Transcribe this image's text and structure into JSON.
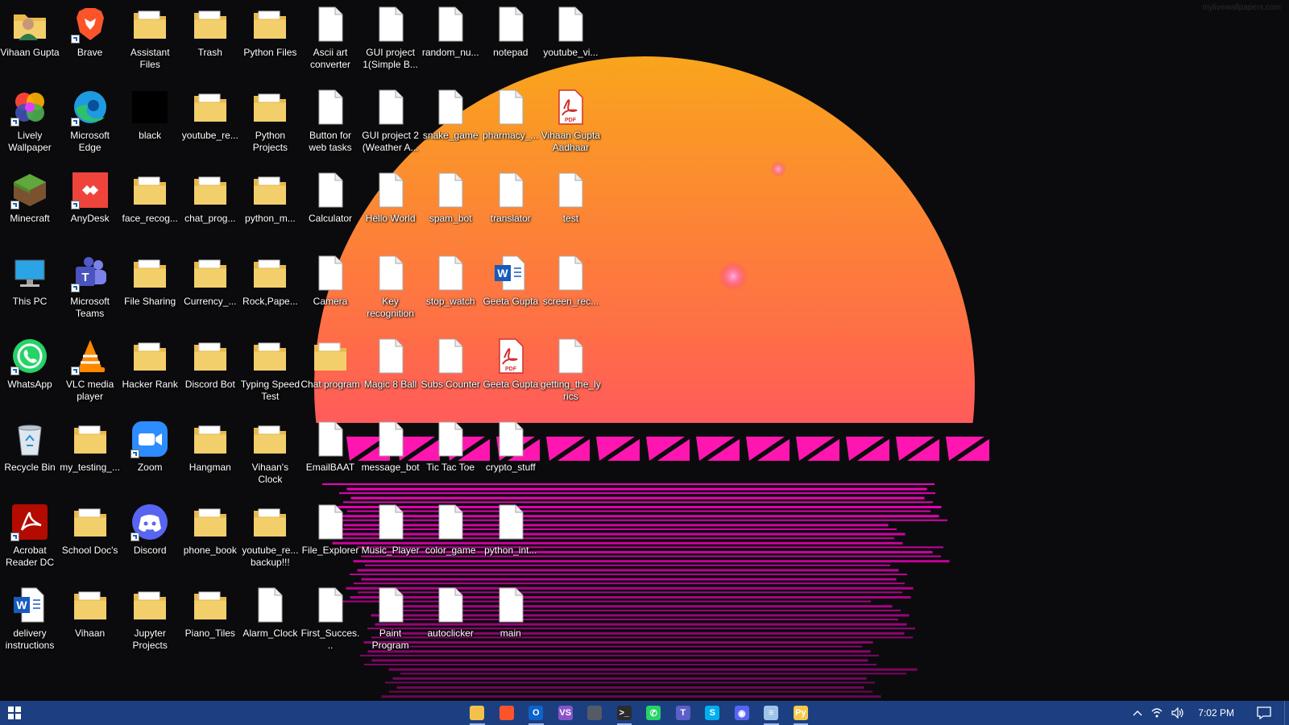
{
  "watermark": "mylivewallpapers.com",
  "colors": {
    "taskbar": "#1c3f82",
    "sun_top": "#f7a21b",
    "sun_bottom": "#ff1fa5",
    "water": "#ff00c8",
    "folder": "#f3cf6c"
  },
  "desktop": {
    "icons": [
      {
        "label": "Vihaan Gupta",
        "type": "user-folder"
      },
      {
        "label": "Lively Wallpaper",
        "type": "lively",
        "shortcut": true
      },
      {
        "label": "Minecraft",
        "type": "minecraft",
        "shortcut": true
      },
      {
        "label": "This PC",
        "type": "this-pc"
      },
      {
        "label": "WhatsApp",
        "type": "whatsapp",
        "shortcut": true
      },
      {
        "label": "Recycle Bin",
        "type": "recycle-bin"
      },
      {
        "label": "Acrobat Reader DC",
        "type": "acrobat",
        "shortcut": true
      },
      {
        "label": "delivery instructions",
        "type": "word-doc"
      },
      {
        "label": "Brave",
        "type": "brave",
        "shortcut": true
      },
      {
        "label": "Microsoft Edge",
        "type": "edge",
        "shortcut": true
      },
      {
        "label": "AnyDesk",
        "type": "anydesk",
        "shortcut": true
      },
      {
        "label": "Microsoft Teams",
        "type": "teams",
        "shortcut": true
      },
      {
        "label": "VLC media player",
        "type": "vlc",
        "shortcut": true
      },
      {
        "label": "my_testing_...",
        "type": "folder"
      },
      {
        "label": "School Doc's",
        "type": "folder"
      },
      {
        "label": "Vihaan",
        "type": "folder"
      },
      {
        "label": "Assistant Files",
        "type": "folder"
      },
      {
        "label": "black",
        "type": "black-image"
      },
      {
        "label": "face_recog...",
        "type": "folder"
      },
      {
        "label": "File Sharing",
        "type": "folder"
      },
      {
        "label": "Hacker Rank",
        "type": "folder"
      },
      {
        "label": "Zoom",
        "type": "zoom",
        "shortcut": true
      },
      {
        "label": "Discord",
        "type": "discord",
        "shortcut": true
      },
      {
        "label": "Jupyter Projects",
        "type": "folder"
      },
      {
        "label": "Trash",
        "type": "folder"
      },
      {
        "label": "youtube_re...",
        "type": "folder"
      },
      {
        "label": "chat_prog...",
        "type": "folder"
      },
      {
        "label": "Currency_...",
        "type": "folder"
      },
      {
        "label": "Discord Bot",
        "type": "folder"
      },
      {
        "label": "Hangman",
        "type": "folder"
      },
      {
        "label": "phone_book",
        "type": "folder"
      },
      {
        "label": "Piano_Tiles",
        "type": "folder"
      },
      {
        "label": "Python Files",
        "type": "folder"
      },
      {
        "label": "Python Projects",
        "type": "folder"
      },
      {
        "label": "python_m...",
        "type": "folder"
      },
      {
        "label": "Rock,Pape...",
        "type": "folder"
      },
      {
        "label": "Typing Speed Test",
        "type": "folder"
      },
      {
        "label": "Vihaan's Clock",
        "type": "folder"
      },
      {
        "label": "youtube_re... backup!!!",
        "type": "folder"
      },
      {
        "label": "Alarm_Clock",
        "type": "file"
      },
      {
        "label": "Ascii art converter",
        "type": "file"
      },
      {
        "label": "Button for web tasks",
        "type": "file"
      },
      {
        "label": "Calculator",
        "type": "file"
      },
      {
        "label": "Camera",
        "type": "file"
      },
      {
        "label": "Chat program",
        "type": "folder"
      },
      {
        "label": "EmailBAAT",
        "type": "file"
      },
      {
        "label": "File_Explorer",
        "type": "file"
      },
      {
        "label": "First_Succes...",
        "type": "file"
      },
      {
        "label": "GUI project 1(Simple B...",
        "type": "file"
      },
      {
        "label": "GUI project 2 (Weather A...",
        "type": "file"
      },
      {
        "label": "Hello World",
        "type": "file"
      },
      {
        "label": "Key recognition",
        "type": "file"
      },
      {
        "label": "Magic 8 Ball",
        "type": "file"
      },
      {
        "label": "message_bot",
        "type": "file"
      },
      {
        "label": "Music_Player",
        "type": "file"
      },
      {
        "label": "Paint Program",
        "type": "file"
      },
      {
        "label": "random_nu...",
        "type": "file"
      },
      {
        "label": "snake_game",
        "type": "file"
      },
      {
        "label": "spam_bot",
        "type": "file"
      },
      {
        "label": "stop_watch",
        "type": "file"
      },
      {
        "label": "Subs Counter",
        "type": "file"
      },
      {
        "label": "Tic Tac Toe",
        "type": "file"
      },
      {
        "label": "color_game",
        "type": "file"
      },
      {
        "label": "autoclicker",
        "type": "file"
      },
      {
        "label": "notepad",
        "type": "file"
      },
      {
        "label": "pharmacy_...",
        "type": "file"
      },
      {
        "label": "translator",
        "type": "file"
      },
      {
        "label": "Geeta Gupta",
        "type": "word-doc"
      },
      {
        "label": "Geeta Gupta",
        "type": "pdf"
      },
      {
        "label": "crypto_stuff",
        "type": "file"
      },
      {
        "label": "python_int...",
        "type": "file"
      },
      {
        "label": "main",
        "type": "file"
      },
      {
        "label": "youtube_vi...",
        "type": "file"
      },
      {
        "label": "Vihaan Gupta Aadhaar",
        "type": "pdf"
      },
      {
        "label": "test",
        "type": "file"
      },
      {
        "label": "screen_rec...",
        "type": "file"
      },
      {
        "label": "getting_the_lyrics",
        "type": "file"
      }
    ]
  },
  "taskbar": {
    "start_icon": "windows-logo-icon",
    "apps": [
      {
        "name": "file-explorer",
        "glyph": "",
        "color": "#f2c14b",
        "running": true
      },
      {
        "name": "brave",
        "glyph": "",
        "color": "#fb542b",
        "running": false
      },
      {
        "name": "outlook",
        "glyph": "O",
        "color": "#0a64c9",
        "running": true
      },
      {
        "name": "visual-studio",
        "glyph": "VS",
        "color": "#8a54c7",
        "running": false
      },
      {
        "name": "window",
        "glyph": "",
        "color": "#555b66",
        "running": false
      },
      {
        "name": "terminal",
        "glyph": ">_",
        "color": "#2b2b2b",
        "running": true
      },
      {
        "name": "whatsapp",
        "glyph": "✆",
        "color": "#25d366",
        "running": false
      },
      {
        "name": "teams",
        "glyph": "T",
        "color": "#5b5fc7",
        "running": false
      },
      {
        "name": "skype",
        "glyph": "S",
        "color": "#00aff0",
        "running": false
      },
      {
        "name": "discord",
        "glyph": "◉",
        "color": "#5865f2",
        "running": false
      },
      {
        "name": "notepad",
        "glyph": "≡",
        "color": "#9fc4e8",
        "running": true
      },
      {
        "name": "python-idle",
        "glyph": "Py",
        "color": "#f7c948",
        "running": true
      }
    ],
    "tray": {
      "time": "7:02 PM"
    }
  }
}
